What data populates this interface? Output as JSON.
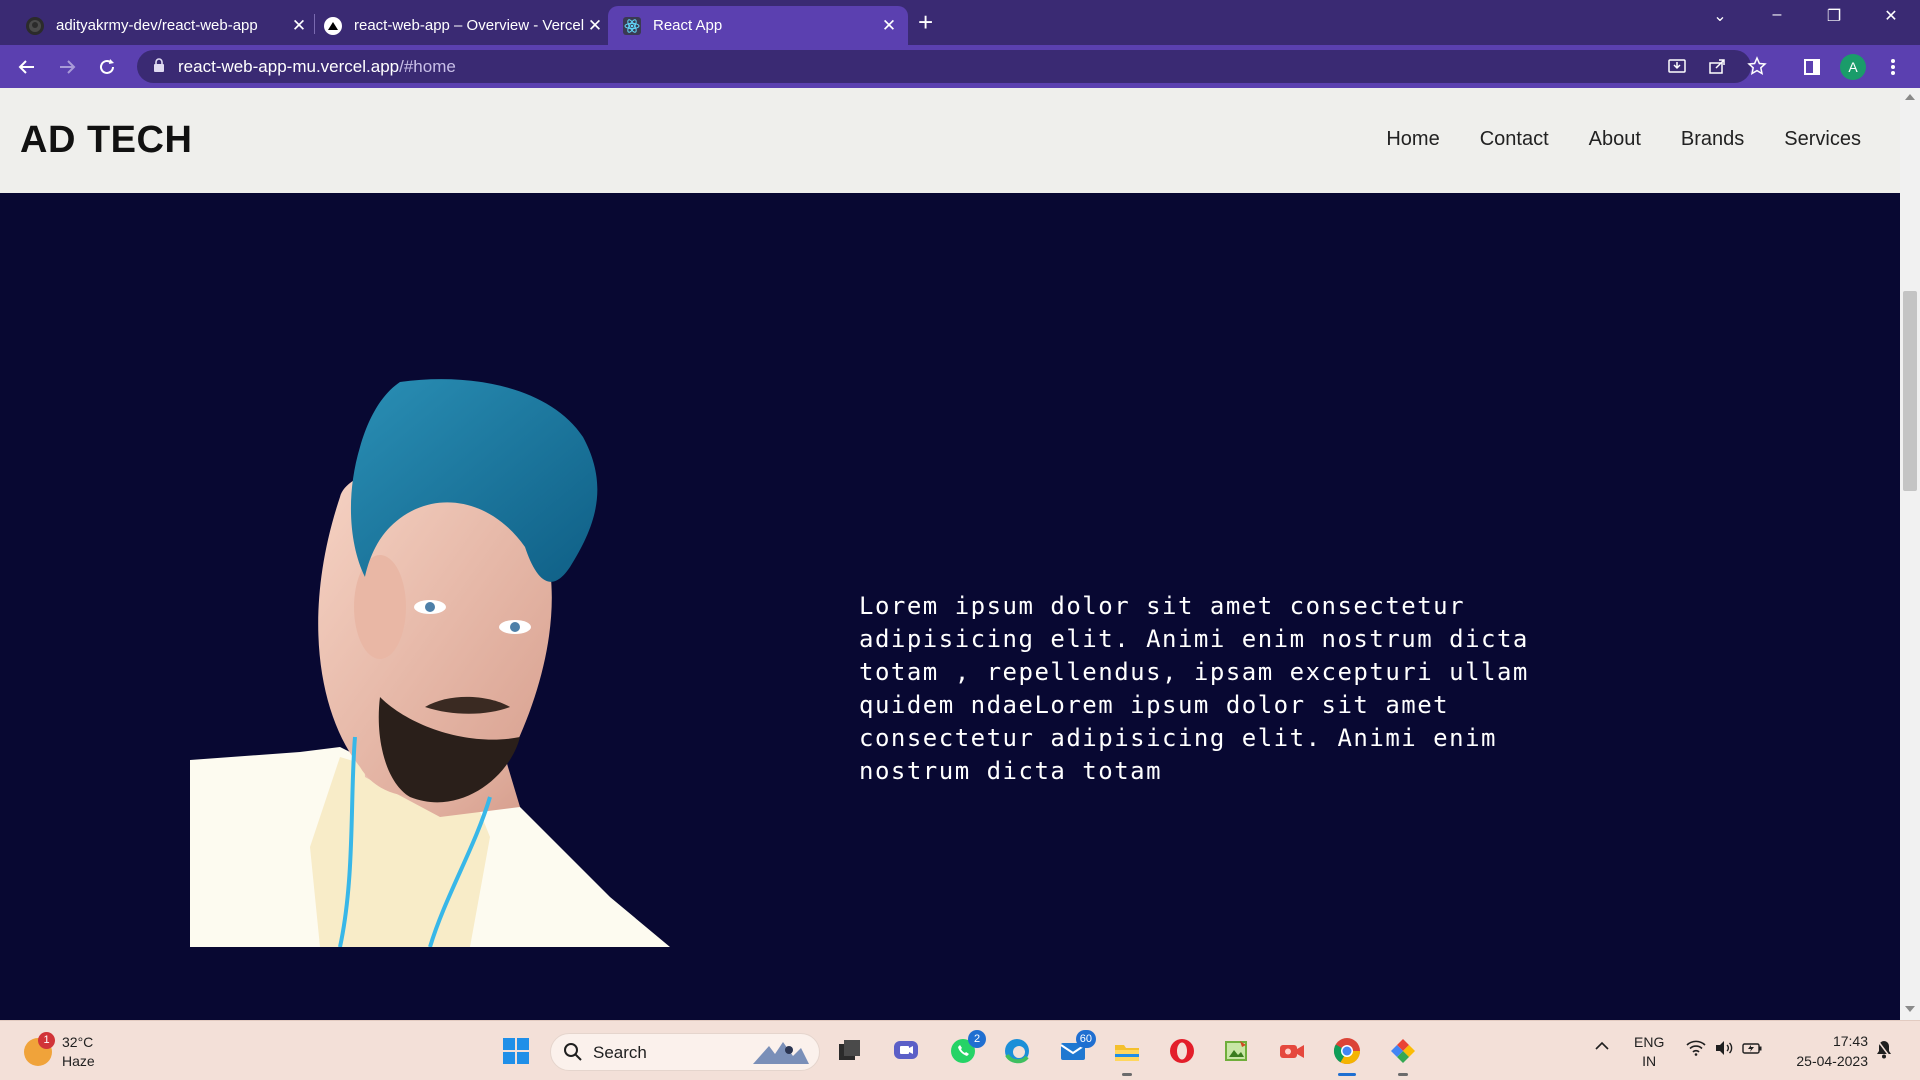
{
  "browser": {
    "tabs": [
      {
        "title": "adityakrmy-dev/react-web-app",
        "favicon": "github-icon"
      },
      {
        "title": "react-web-app – Overview - Vercel",
        "favicon": "vercel-icon"
      },
      {
        "title": "React App",
        "favicon": "react-icon",
        "active": true
      }
    ],
    "url_host": "react-web-app-mu.vercel.app",
    "url_path": "/#home",
    "profile_initial": "A"
  },
  "site": {
    "brand": "AD TECH",
    "nav": [
      "Home",
      "Contact",
      "About",
      "Brands",
      "Services"
    ],
    "hero_text": "Lorem ipsum dolor sit amet consectetur adipisicing elit. Animi enim nostrum dicta totam , repellendus, ipsam excepturi ullam quidem ndaeLorem ipsum dolor sit amet consectetur adipisicing elit. Animi enim nostrum dicta totam"
  },
  "taskbar": {
    "weather": {
      "temp": "32°C",
      "desc": "Haze",
      "badge": "1"
    },
    "search_label": "Search",
    "badges": {
      "whatsapp": "2",
      "mail": "60"
    },
    "lang_top": "ENG",
    "lang_bottom": "IN",
    "time": "17:43",
    "date": "25-04-2023"
  },
  "colors": {
    "tabbar": "#3a2a73",
    "toolbar": "#5b40b0",
    "page_bg": "#080832",
    "header_bg": "#efefec",
    "taskbar_bg": "#f3e0d8"
  }
}
